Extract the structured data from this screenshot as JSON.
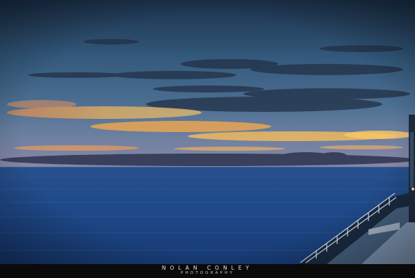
{
  "watermark": {
    "name": "NOLAN CONLEY",
    "subtitle": "PHOTOGRAPHY"
  },
  "palette": {
    "sky_top": "#1d3550",
    "sky_mid": "#3f6687",
    "sunset_orange": "#f0a24a",
    "cloud_dark": "#2a3346",
    "sea_blue": "#1d4a8a",
    "deck": "#9fb3cc"
  }
}
